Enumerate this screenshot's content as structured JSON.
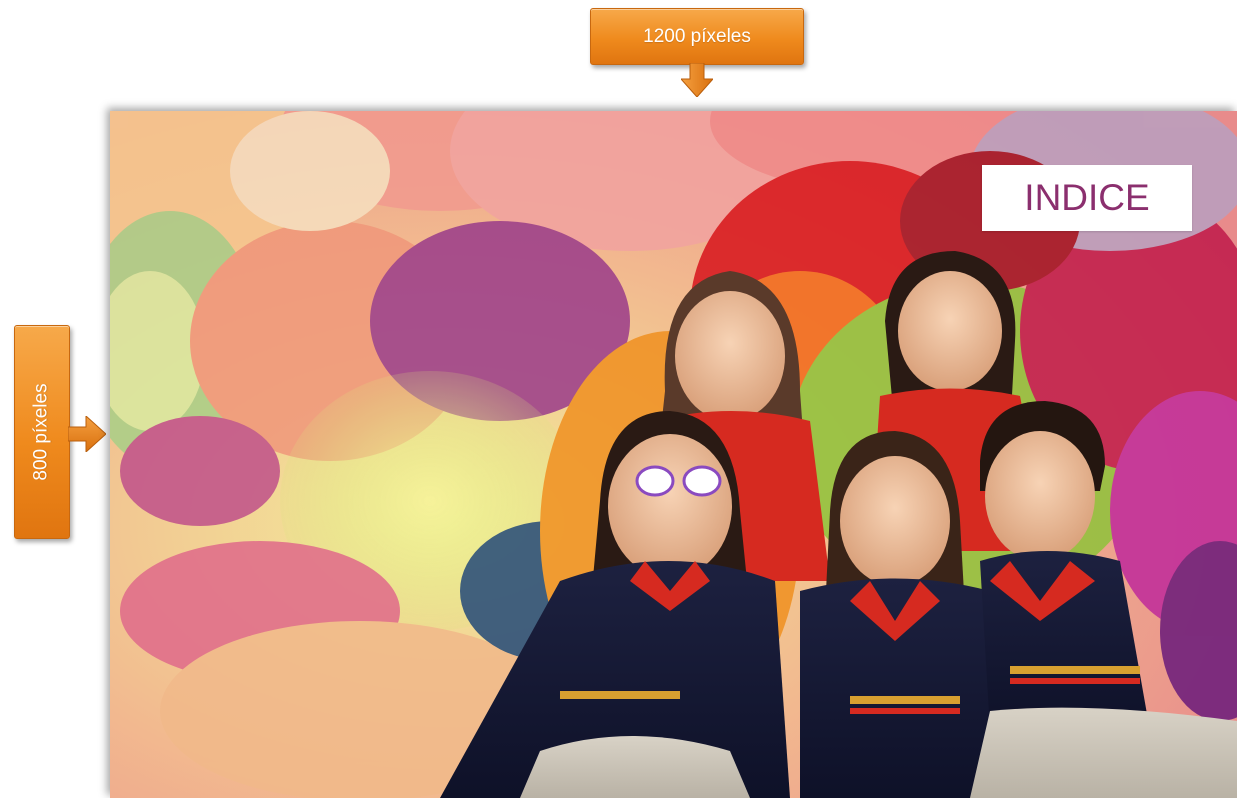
{
  "labels": {
    "width_label": "1200 píxeles",
    "height_label": "800 píxeles"
  },
  "picture": {
    "overlay_title": "INDICE",
    "title_color": "#8b2f6e",
    "callout_color": "#ef8a1d"
  }
}
